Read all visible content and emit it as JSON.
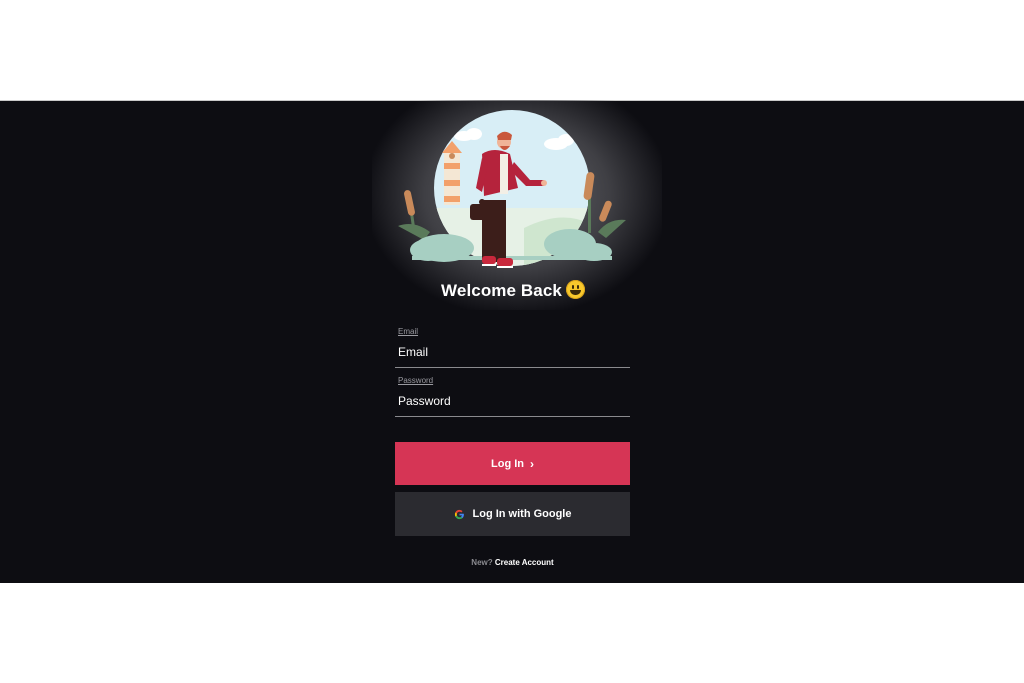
{
  "header": {
    "title": "Welcome Back"
  },
  "form": {
    "email": {
      "label": "Email",
      "placeholder": "Email",
      "value": ""
    },
    "password": {
      "label": "Password",
      "placeholder": "Password",
      "value": ""
    }
  },
  "actions": {
    "login_label": "Log In",
    "google_label": "Log In with Google"
  },
  "footer": {
    "new_text": "New?",
    "create_label": "Create Account"
  },
  "icons": {
    "welcome": "grinning-face-emoji",
    "login": "chevron-right-icon",
    "google": "google-g-icon"
  },
  "colors": {
    "background": "#0d0d12",
    "accent": "#d63555",
    "secondary_button": "#2b2b30",
    "text": "#ffffff",
    "muted_text": "#8b8b90"
  }
}
